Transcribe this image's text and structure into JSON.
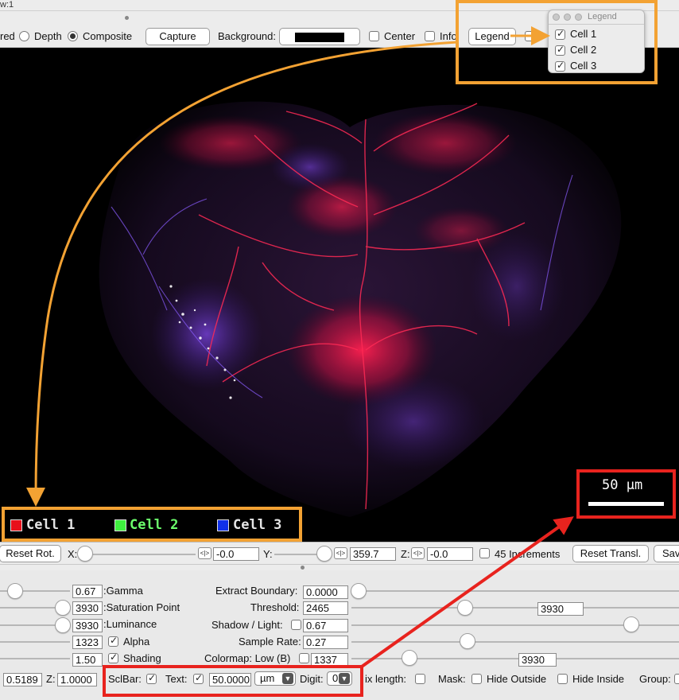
{
  "window": {
    "title": "w:1"
  },
  "toolbar": {
    "render_mode_cut": "red",
    "depth_label": "Depth",
    "composite_label": "Composite",
    "capture_label": "Capture",
    "background_label": "Background:",
    "background_color": "#000000",
    "center_label": "Center",
    "info_label": "Info",
    "legend_label": "Legend"
  },
  "legend_window": {
    "title": "Legend",
    "items": [
      {
        "label": "Cell 1",
        "checked": true
      },
      {
        "label": "Cell 2",
        "checked": true
      },
      {
        "label": "Cell 3",
        "checked": true
      }
    ]
  },
  "view_legend": {
    "items": [
      {
        "label": "Cell 1",
        "color": "#e8101a"
      },
      {
        "label": "Cell 2",
        "color": "#3ff03f"
      },
      {
        "label": "Cell 3",
        "color": "#1030e8"
      }
    ]
  },
  "scale_bar": {
    "text": "50 µm"
  },
  "rotation": {
    "reset_rot_label": "Reset Rot.",
    "x_label": "X:",
    "x_value": "-0.0",
    "y_label": "Y:",
    "y_value": "359.7",
    "z_label": "Z:",
    "z_value": "-0.0",
    "increments_label": "45 Increments",
    "reset_transl_label": "Reset Transl.",
    "save_label_cut": "Sav"
  },
  "properties": {
    "gamma_value": "0.67",
    "gamma_label": ":Gamma",
    "saturation_value": "3930",
    "saturation_label": ":Saturation Point",
    "luminance_value": "3930",
    "luminance_label": ":Luminance",
    "alpha_value": "1323",
    "alpha_label": "Alpha",
    "shading_value": "1.50",
    "shading_label": "Shading",
    "extract_boundary_label": "Extract Boundary:",
    "extract_boundary_value": "0.0000",
    "threshold_label": "Threshold:",
    "threshold_value": "2465",
    "threshold_high": "3930",
    "shadow_label": "Shadow / Light:",
    "shadow_value": "0.67",
    "sample_rate_label": "Sample Rate:",
    "sample_rate_value": "0.27",
    "colormap_label": "Colormap: Low (B)",
    "colormap_low": "1337",
    "colormap_high": "3930"
  },
  "bottom_bar": {
    "left_value_cut": "0.5189",
    "z_label": "Z:",
    "z_value": "1.0000",
    "sclbar_label": "SclBar:",
    "text_label": "Text:",
    "text_value": "50.0000",
    "unit_value": "µm",
    "digit_label": "Digit:",
    "digit_value": "0",
    "fix_length_label": "ix length:",
    "mask_label": "Mask:",
    "hide_outside_label": "Hide Outside",
    "hide_inside_label": "Hide Inside",
    "group_label": "Group:"
  }
}
